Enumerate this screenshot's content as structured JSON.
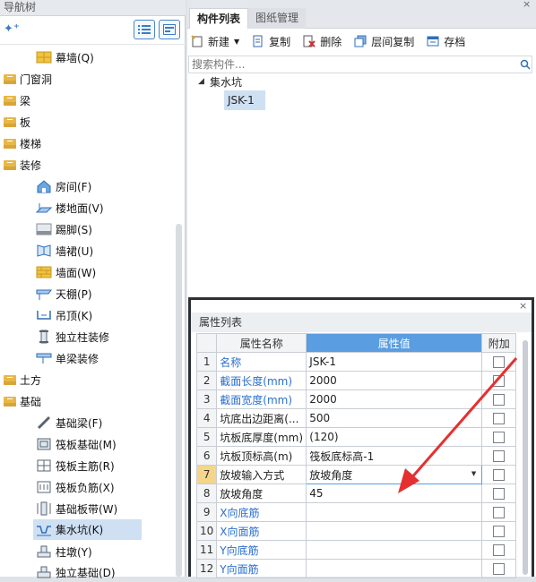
{
  "nav": {
    "title": "导航树",
    "items": [
      {
        "label": "幕墙(Q)",
        "icon": "curtain-wall-icon"
      },
      {
        "label": "门窗洞"
      },
      {
        "label": "梁"
      },
      {
        "label": "板"
      },
      {
        "label": "楼梯"
      },
      {
        "label": "装修"
      },
      {
        "label": "房间(F)",
        "icon": "room-icon"
      },
      {
        "label": "楼地面(V)",
        "icon": "floor-icon"
      },
      {
        "label": "踢脚(S)",
        "icon": "skirting-icon"
      },
      {
        "label": "墙裙(U)",
        "icon": "dado-icon"
      },
      {
        "label": "墙面(W)",
        "icon": "wall-surface-icon"
      },
      {
        "label": "天棚(P)",
        "icon": "ceiling-icon"
      },
      {
        "label": "吊顶(K)",
        "icon": "suspended-ceiling-icon"
      },
      {
        "label": "独立柱装修",
        "icon": "column-finish-icon"
      },
      {
        "label": "单梁装修",
        "icon": "beam-finish-icon"
      },
      {
        "label": "土方"
      },
      {
        "label": "基础"
      },
      {
        "label": "基础梁(F)",
        "icon": "foundation-beam-icon"
      },
      {
        "label": "筏板基础(M)",
        "icon": "raft-foundation-icon"
      },
      {
        "label": "筏板主筋(R)",
        "icon": "raft-main-rebar-icon"
      },
      {
        "label": "筏板负筋(X)",
        "icon": "raft-negative-rebar-icon"
      },
      {
        "label": "基础板带(W)",
        "icon": "foundation-strip-icon"
      },
      {
        "label": "集水坑(K)",
        "icon": "sump-pit-icon"
      },
      {
        "label": "柱墩(Y)",
        "icon": "column-pier-icon"
      },
      {
        "label": "独立基础(D)",
        "icon": "isolated-footing-icon"
      }
    ]
  },
  "tabs": {
    "list": "构件列表",
    "drawing": "图纸管理"
  },
  "toolbar": {
    "new": "新建",
    "copy": "复制",
    "delete": "删除",
    "floor_copy": "层间复制",
    "save": "存档"
  },
  "search": {
    "placeholder": "搜索构件..."
  },
  "component_tree": {
    "group": "集水坑",
    "item": "JSK-1"
  },
  "props": {
    "title": "属性列表",
    "headers": {
      "name": "属性名称",
      "value": "属性值",
      "extra": "附加"
    },
    "rows": [
      {
        "n": "1",
        "name": "名称",
        "value": "JSK-1"
      },
      {
        "n": "2",
        "name": "截面长度(mm)",
        "value": "2000"
      },
      {
        "n": "3",
        "name": "截面宽度(mm)",
        "value": "2000"
      },
      {
        "n": "4",
        "name": "坑底出边距离(...",
        "value": "500"
      },
      {
        "n": "5",
        "name": "坑板底厚度(mm)",
        "value": "(120)"
      },
      {
        "n": "6",
        "name": "坑板顶标高(m)",
        "value": "筏板底标高-1"
      },
      {
        "n": "7",
        "name": "放坡输入方式",
        "value": "放坡角度"
      },
      {
        "n": "8",
        "name": "放坡角度",
        "value": "45"
      },
      {
        "n": "9",
        "name": "X向底筋",
        "value": ""
      },
      {
        "n": "10",
        "name": "X向面筋",
        "value": ""
      },
      {
        "n": "11",
        "name": "Y向底筋",
        "value": ""
      },
      {
        "n": "12",
        "name": "Y向面筋",
        "value": ""
      }
    ]
  },
  "colors": {
    "accent": "#5a9de0",
    "link": "#2a6fd0",
    "annotation": "#e53030"
  }
}
